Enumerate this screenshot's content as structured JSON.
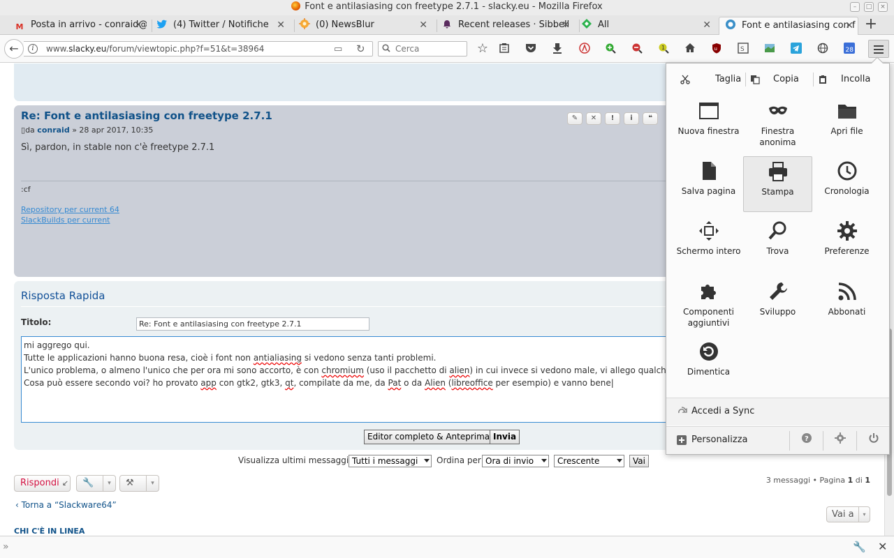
{
  "window": {
    "title": "Font e antilasiasing con freetype 2.7.1 - slacky.eu - Mozilla Firefox"
  },
  "tabs": [
    {
      "label": "Posta in arrivo - conraid@",
      "icon": "gmail-icon",
      "active": false
    },
    {
      "label": "(4) Twitter / Notifiche",
      "icon": "twitter-icon",
      "active": false
    },
    {
      "label": "(0) NewsBlur",
      "icon": "newsblur-icon",
      "active": false
    },
    {
      "label": "Recent releases · Sibbell",
      "icon": "sibbell-icon",
      "active": false
    },
    {
      "label": "All",
      "icon": "feedly-icon",
      "active": false
    },
    {
      "label": "Font e antilasiasing con f",
      "icon": "slacky-icon",
      "active": true
    }
  ],
  "navbar": {
    "url_prefix": "www.",
    "url_domain": "slacky.eu",
    "url_path": "/forum/viewtopic.php?f=51&t=38964",
    "search_placeholder": "Cerca",
    "calendar_day": "28"
  },
  "post": {
    "title": "Re: Font e antilasiasing con freetype 2.7.1",
    "author_prefix": "da",
    "author": "conraid",
    "date": "» 28 apr 2017, 10:35",
    "body": "Sì, pardon, in stable non c'è freetype 2.7.1",
    "signature": ":cf",
    "links": [
      "Repository per current 64",
      "SlackBuilds per current"
    ],
    "buttons": [
      "✎",
      "✕",
      "!",
      "i",
      "❝"
    ]
  },
  "quick_reply": {
    "heading": "Risposta Rapida",
    "title_label": "Titolo:",
    "title_value": "Re: Font e antilasiasing con freetype 2.7.1",
    "message_lines": [
      "mi aggrego qui.",
      "Tutte le applicazioni hanno buona resa, cioè i font non antialiasing si vedono senza tanti problemi.",
      "L'unico problema, o almeno l'unico che per ora mi sono accorto, è con chromium (uso il pacchetto di alien) in cui invece si vedono male, vi allego qualche ese",
      "Cosa può essere secondo voi? ho provato app con gtk2, gtk3, qt, compilate da me, da Pat o da Alien (libreoffice per esempio) e vanno bene"
    ],
    "preview_button": "Editor completo & Anteprima",
    "send_button": "Invia"
  },
  "sort": {
    "show_label": "Visualizza ultimi messaggi:",
    "show_value": "Tutti i messaggi",
    "order_label": "Ordina per",
    "order_value": "Ora di invio",
    "direction_value": "Crescente",
    "go_button": "Vai"
  },
  "actions": {
    "reply_button": "Rispondi",
    "page_info_prefix": "3 messaggi • Pagina",
    "page_current": "1",
    "page_of": "di",
    "page_total": "1",
    "back_link": "Torna a “Slackware64”",
    "goto_button": "Vai a",
    "online_heading": "CHI C'È IN LINEA"
  },
  "menu_panel": {
    "edit": {
      "cut": "Taglia",
      "copy": "Copia",
      "paste": "Incolla"
    },
    "items": [
      {
        "label": "Nuova finestra",
        "icon": "new-window-icon"
      },
      {
        "label": "Finestra anonima",
        "icon": "private-mask-icon"
      },
      {
        "label": "Apri file",
        "icon": "folder-icon"
      },
      {
        "label": "Salva pagina",
        "icon": "save-page-icon"
      },
      {
        "label": "Stampa",
        "icon": "printer-icon"
      },
      {
        "label": "Cronologia",
        "icon": "history-clock-icon"
      },
      {
        "label": "Schermo intero",
        "icon": "fullscreen-icon"
      },
      {
        "label": "Trova",
        "icon": "find-icon"
      },
      {
        "label": "Preferenze",
        "icon": "preferences-gear-icon"
      },
      {
        "label": "Componenti aggiuntivi",
        "icon": "addons-puzzle-icon"
      },
      {
        "label": "Sviluppo",
        "icon": "developer-wrench-icon"
      },
      {
        "label": "Abbonati",
        "icon": "subscribe-rss-icon"
      },
      {
        "label": "Dimentica",
        "icon": "forget-icon"
      }
    ],
    "sync_label": "Accedi a Sync",
    "customize_label": "Personalizza"
  }
}
